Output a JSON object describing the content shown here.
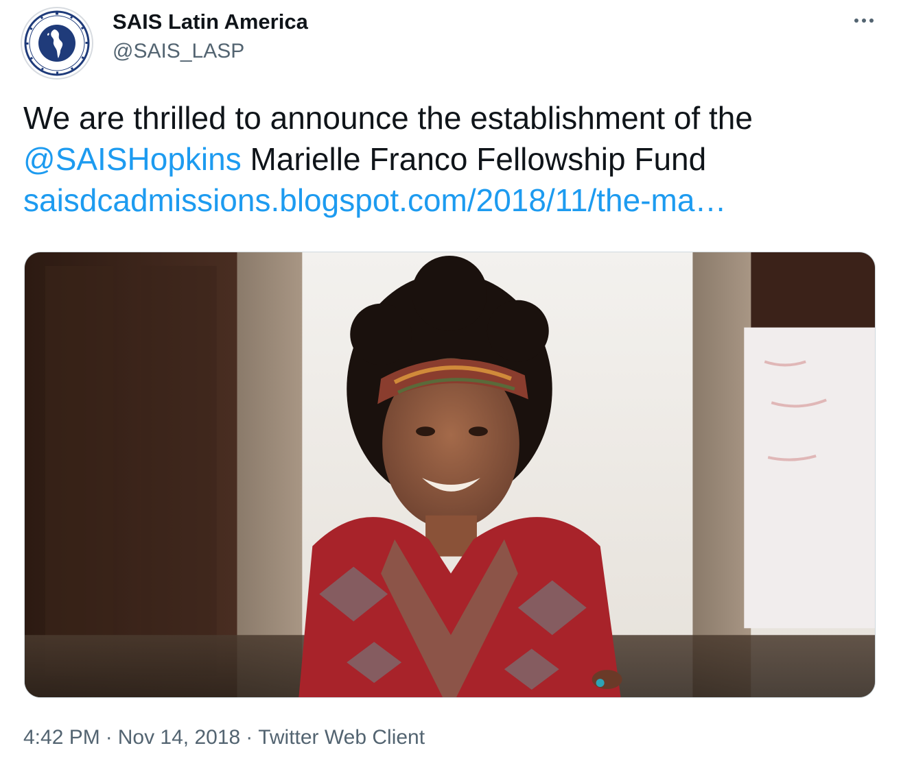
{
  "author": {
    "display_name": "SAIS Latin America",
    "handle": "@SAIS_LASP",
    "avatar_seal_text": "JOHNS HOPKINS UNIVERSITY · LATIN AMERICAN STUDIES PROGRAM · SAIS"
  },
  "more_menu": {
    "icon": "more-horizontal-icon"
  },
  "tweet": {
    "text_line1": "We are thrilled to announce the establishment of the",
    "mention": "@SAISHopkins",
    "text_line2_rest": " Marielle Franco Fellowship Fund",
    "url": "saisdcadmissions.blogspot.com/2018/11/the-ma…"
  },
  "media": {
    "kind": "photo"
  },
  "meta": {
    "time": "4:42 PM",
    "date": "Nov 14, 2018",
    "source": "Twitter Web Client",
    "separator": "·"
  },
  "colors": {
    "link": "#1d9bf0",
    "secondary_text": "#536471",
    "primary_text": "#0f1419",
    "border": "#cfd9de"
  }
}
